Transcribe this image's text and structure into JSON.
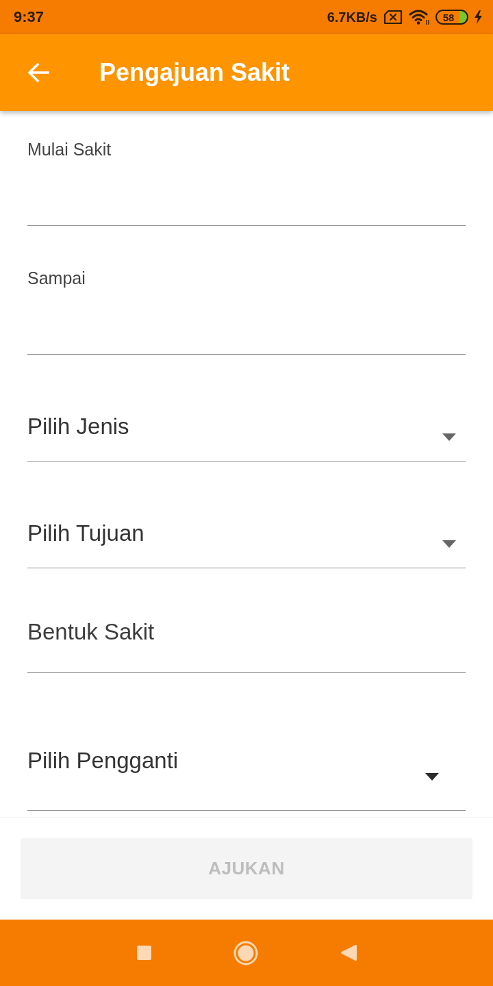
{
  "status_bar": {
    "time": "9:37",
    "network_speed": "6.7KB/s",
    "battery": "58"
  },
  "app_bar": {
    "title": "Pengajuan Sakit"
  },
  "form": {
    "fields": [
      {
        "kind": "date",
        "label": "Mulai Sakit"
      },
      {
        "kind": "date",
        "label": "Sampai"
      },
      {
        "kind": "dropdown",
        "hint": "Pilih Jenis"
      },
      {
        "kind": "dropdown",
        "hint": "Pilih Tujuan"
      },
      {
        "kind": "text",
        "placeholder": "Bentuk Sakit"
      },
      {
        "kind": "dropdown",
        "hint": "Pilih Pengganti"
      }
    ]
  },
  "submit_button": {
    "label": "AJUKAN",
    "disabled": true
  }
}
